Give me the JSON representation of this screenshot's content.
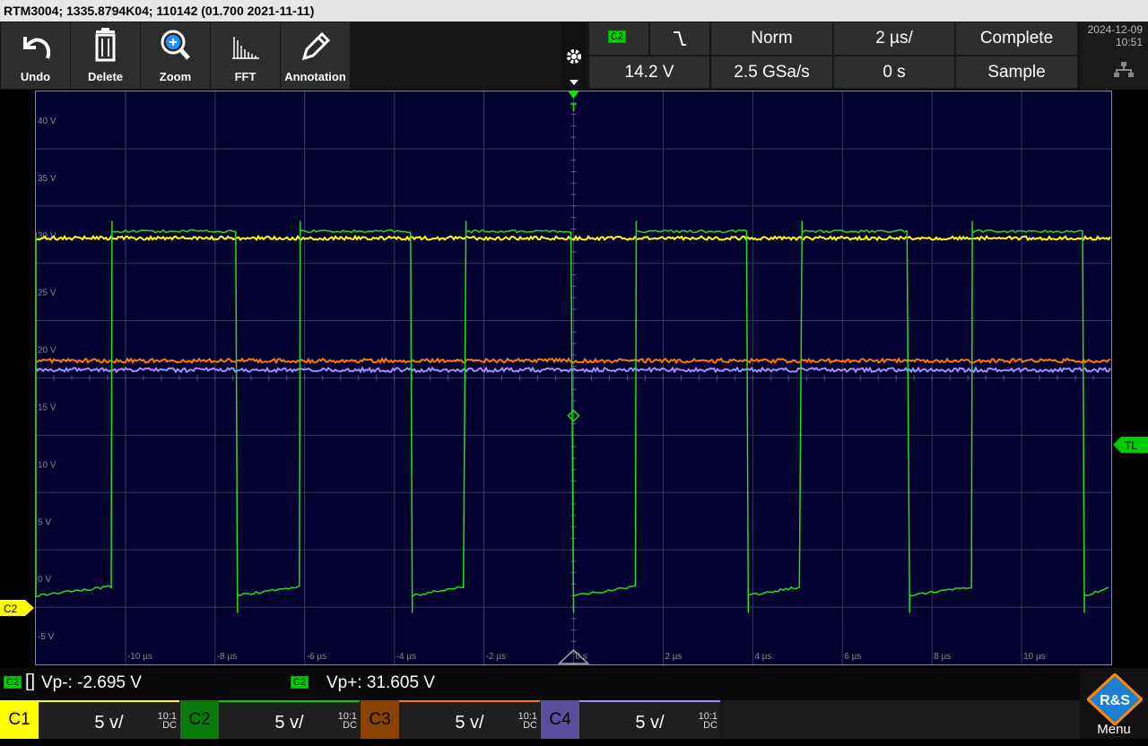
{
  "title_bar": "RTM3004; 1335.8794K04; 110142 (01.700 2021-11-11)",
  "toolbar": {
    "buttons": [
      {
        "label": "Undo",
        "icon": "undo-icon"
      },
      {
        "label": "Delete",
        "icon": "trash-icon"
      },
      {
        "label": "Zoom",
        "icon": "zoom-icon"
      },
      {
        "label": "FFT",
        "icon": "fft-icon"
      },
      {
        "label": "Annotation",
        "icon": "pencil-icon"
      }
    ]
  },
  "settings": {
    "trigger_source": "C2",
    "trigger_slope_icon": "falling-edge-icon",
    "trigger_mode": "Norm",
    "time_scale": "2 µs/",
    "acq_state": "Complete",
    "trigger_level": "14.2 V",
    "sample_rate": "2.5 GSa/s",
    "time_offset": "0 s",
    "acq_mode": "Sample"
  },
  "datetime": {
    "date": "2024-12-09",
    "time": "10:51"
  },
  "grid": {
    "y_labels": [
      "40 V",
      "35 V",
      "30 V",
      "25 V",
      "20 V",
      "15 V",
      "10 V",
      "5 V",
      "0 V",
      "-5 V"
    ],
    "x_labels": [
      "-10 µs",
      "-8 µs",
      "-6 µs",
      "-4 µs",
      "-2 µs",
      "0 s",
      "2 µs",
      "4 µs",
      "6 µs",
      "8 µs",
      "10 µs"
    ],
    "trigger_marker": "T",
    "trigger_level_marker": "TL",
    "ref_marker": "C2"
  },
  "measurements": {
    "vp_minus": {
      "channel": "C2",
      "label": "Vp-: -2.695 V"
    },
    "vp_plus": {
      "channel": "C2",
      "label": "Vp+: 31.605 V"
    }
  },
  "channels": [
    {
      "name": "C1",
      "scale": "5 v/",
      "coupling": "DC",
      "probe": "10:1",
      "color": "#ffff00"
    },
    {
      "name": "C2",
      "scale": "5 v/",
      "coupling": "DC",
      "probe": "10:1",
      "color": "#00cc00"
    },
    {
      "name": "C3",
      "scale": "5 v/",
      "coupling": "DC",
      "probe": "10:1",
      "color": "#ff7a00"
    },
    {
      "name": "C4",
      "scale": "5 v/",
      "coupling": "DC",
      "probe": "10:1",
      "color": "#a090ff"
    }
  ],
  "menu_label": "Menu",
  "logo_text": "R&S"
}
